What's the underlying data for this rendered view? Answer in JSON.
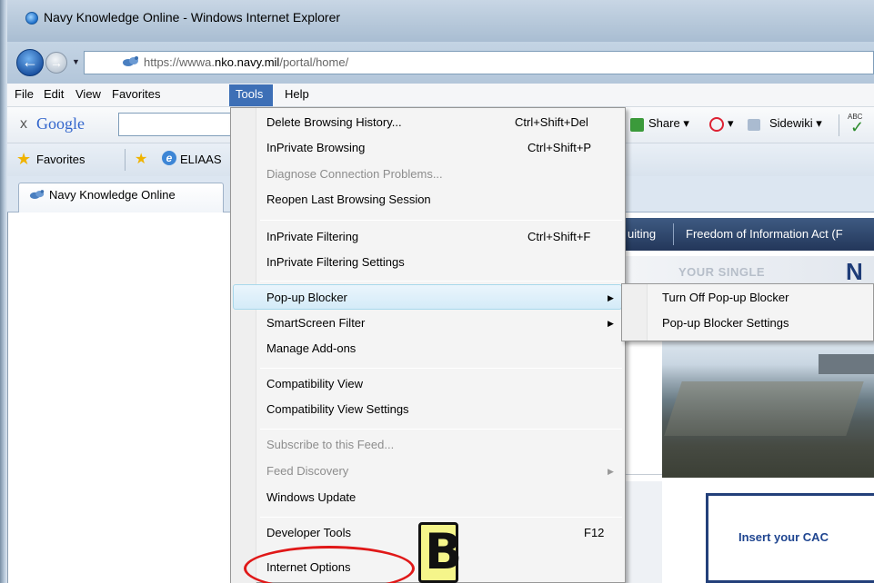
{
  "window": {
    "title": "Navy Knowledge Online - Windows Internet Explorer"
  },
  "address_bar": {
    "url_prefix": "https://wwwa.",
    "url_host": "nko.navy.mil",
    "url_path": "/portal/home/"
  },
  "menubar": {
    "items": [
      "File",
      "Edit",
      "View",
      "Favorites",
      "Tools",
      "Help"
    ],
    "active": "Tools"
  },
  "google_toolbar": {
    "close": "x",
    "logo": "Google",
    "share_label": "Share",
    "sidewiki_label": "Sidewiki",
    "abc": "ABC"
  },
  "favorites_bar": {
    "favorites_label": "Favorites",
    "link_label": "ELIAAS"
  },
  "tab": {
    "label": "Navy Knowledge Online"
  },
  "tools_menu": {
    "items": [
      {
        "label": "Delete Browsing History...",
        "shortcut": "Ctrl+Shift+Del",
        "enabled": true
      },
      {
        "label": "InPrivate Browsing",
        "shortcut": "Ctrl+Shift+P",
        "enabled": true
      },
      {
        "label": "Diagnose Connection Problems...",
        "shortcut": "",
        "enabled": false
      },
      {
        "label": "Reopen Last Browsing Session",
        "shortcut": "",
        "enabled": true
      },
      {
        "label": "InPrivate Filtering",
        "shortcut": "Ctrl+Shift+F",
        "enabled": true
      },
      {
        "label": "InPrivate Filtering Settings",
        "shortcut": "",
        "enabled": true
      },
      {
        "label": "Pop-up Blocker",
        "shortcut": "",
        "enabled": true,
        "submenu": true,
        "highlighted": true
      },
      {
        "label": "SmartScreen Filter",
        "shortcut": "",
        "enabled": true,
        "submenu": true
      },
      {
        "label": "Manage Add-ons",
        "shortcut": "",
        "enabled": true
      },
      {
        "label": "Compatibility View",
        "shortcut": "",
        "enabled": true
      },
      {
        "label": "Compatibility View Settings",
        "shortcut": "",
        "enabled": true
      },
      {
        "label": "Subscribe to this Feed...",
        "shortcut": "",
        "enabled": false
      },
      {
        "label": "Feed Discovery",
        "shortcut": "",
        "enabled": false,
        "submenu": true
      },
      {
        "label": "Windows Update",
        "shortcut": "",
        "enabled": true
      },
      {
        "label": "Developer Tools",
        "shortcut": "F12",
        "enabled": true
      },
      {
        "label": "Internet Options",
        "shortcut": "",
        "enabled": true
      }
    ]
  },
  "popup_submenu": {
    "items": [
      "Turn Off Pop-up Blocker",
      "Pop-up Blocker Settings"
    ]
  },
  "page": {
    "nav_link_1": "uiting",
    "nav_link_2": "Freedom of Information Act (F",
    "banner_text": "YOUR SINGLE",
    "banner_logo": "N",
    "cac_prompt": "Insert your CAC"
  },
  "annotation": {
    "label": "B",
    "highlight_color": "#e01818"
  }
}
